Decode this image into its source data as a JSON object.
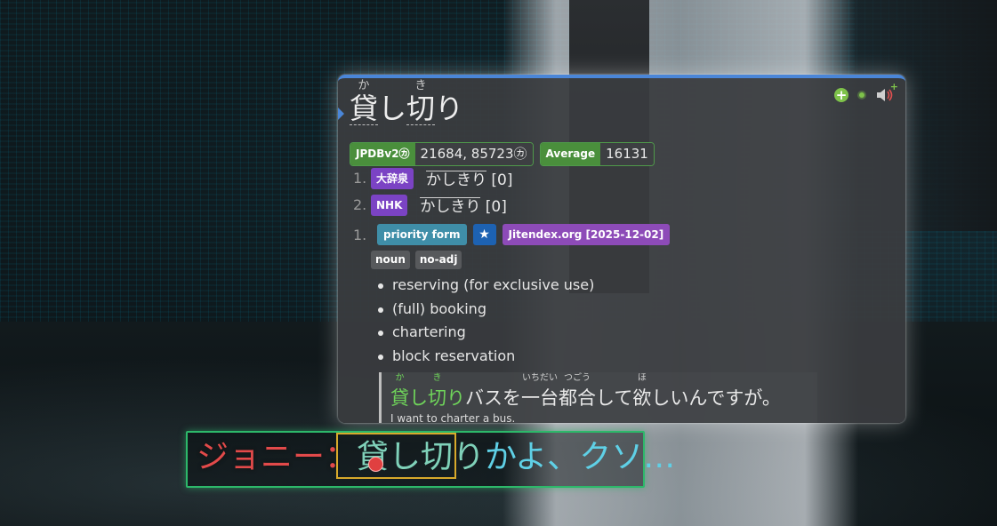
{
  "popup": {
    "headword": [
      {
        "text": "貸",
        "reading": "か"
      },
      {
        "text": "し",
        "reading": ""
      },
      {
        "text": "切",
        "reading": "き"
      },
      {
        "text": "り",
        "reading": ""
      }
    ],
    "actions": {
      "add_icon": "plus-circle-icon",
      "status_icon": "green-dot-icon",
      "audio_icon": "speaker-icon"
    },
    "frequencies": [
      {
        "label": "JPDBv2㋕",
        "value": "21684, 85723㋕"
      },
      {
        "label": "Average",
        "value": "16131"
      }
    ],
    "pitches": [
      {
        "num": "1.",
        "dict": "大辞泉",
        "reading": "かしきり",
        "accent": "[0]"
      },
      {
        "num": "2.",
        "dict": "NHK",
        "reading": "かしきり",
        "accent": "[0]"
      }
    ],
    "definition": {
      "num": "1.",
      "tags": {
        "priority": "priority form",
        "star": "★",
        "source": "Jitendex.org [2025-12-02]"
      },
      "pos": [
        "noun",
        "no-adj"
      ],
      "glosses": [
        "reserving (for exclusive use)",
        "(full) booking",
        "chartering",
        "block reservation"
      ],
      "example": {
        "jp_head": "貸し切り",
        "jp_head_ruby": {
          "ka": "か",
          "ki": "き"
        },
        "jp_tail": "バスを一台都合して欲しいんですが。",
        "ruby": {
          "ichidai": "いちだい",
          "tsugou": "つごう",
          "hoshi": "ほ"
        },
        "en": "I want to charter a bus."
      }
    }
  },
  "subtitle": {
    "speaker": "ジョニー：",
    "word": "貸し切り",
    "rest": "かよ、クソ…"
  },
  "colors": {
    "accent_blue": "#4a86d8",
    "freq_green": "#4a8f3c",
    "dict_purple": "#7b43c4",
    "highlight_green": "#6fd45a",
    "subtitle_border": "#2db86a",
    "selection_box": "#d8a92b",
    "speaker_red": "#e24a4a"
  }
}
